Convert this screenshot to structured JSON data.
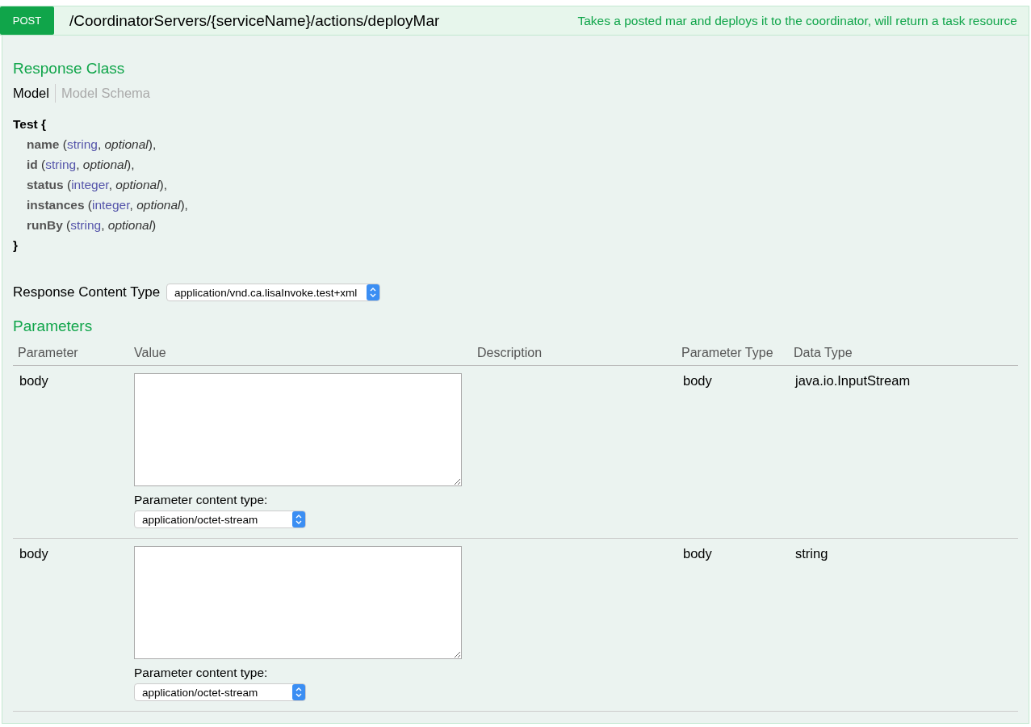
{
  "operation": {
    "method": "POST",
    "path": "/CoordinatorServers/{serviceName}/actions/deployMar",
    "summary": "Takes a posted mar and deploys it to the coordinator, will return a task resource"
  },
  "response_class": {
    "heading": "Response Class",
    "tabs": [
      {
        "label": "Model",
        "selected": true
      },
      {
        "label": "Model Schema",
        "selected": false
      }
    ],
    "model": {
      "name": "Test {",
      "close": "}",
      "properties": [
        {
          "name": "name",
          "open": " (",
          "type": "string",
          "comma": ", ",
          "qualifier": "optional",
          "close": "),"
        },
        {
          "name": "id",
          "open": " (",
          "type": "string",
          "comma": ", ",
          "qualifier": "optional",
          "close": "),"
        },
        {
          "name": "status",
          "open": " (",
          "type": "integer",
          "comma": ", ",
          "qualifier": "optional",
          "close": "),"
        },
        {
          "name": "instances",
          "open": " (",
          "type": "integer",
          "comma": ", ",
          "qualifier": "optional",
          "close": "),"
        },
        {
          "name": "runBy",
          "open": " (",
          "type": "string",
          "comma": ", ",
          "qualifier": "optional",
          "close": ")"
        }
      ]
    }
  },
  "response_content_type": {
    "label": "Response Content Type",
    "value": "application/vnd.ca.lisaInvoke.test+xml"
  },
  "parameters": {
    "heading": "Parameters",
    "columns": [
      "Parameter",
      "Value",
      "Description",
      "Parameter Type",
      "Data Type"
    ],
    "rows": [
      {
        "parameter": "body",
        "content_type_label": "Parameter content type:",
        "content_type": "application/octet-stream",
        "parameter_type": "body",
        "data_type": "java.io.InputStream"
      },
      {
        "parameter": "body",
        "content_type_label": "Parameter content type:",
        "content_type": "application/octet-stream",
        "parameter_type": "body",
        "data_type": "string"
      }
    ]
  }
}
